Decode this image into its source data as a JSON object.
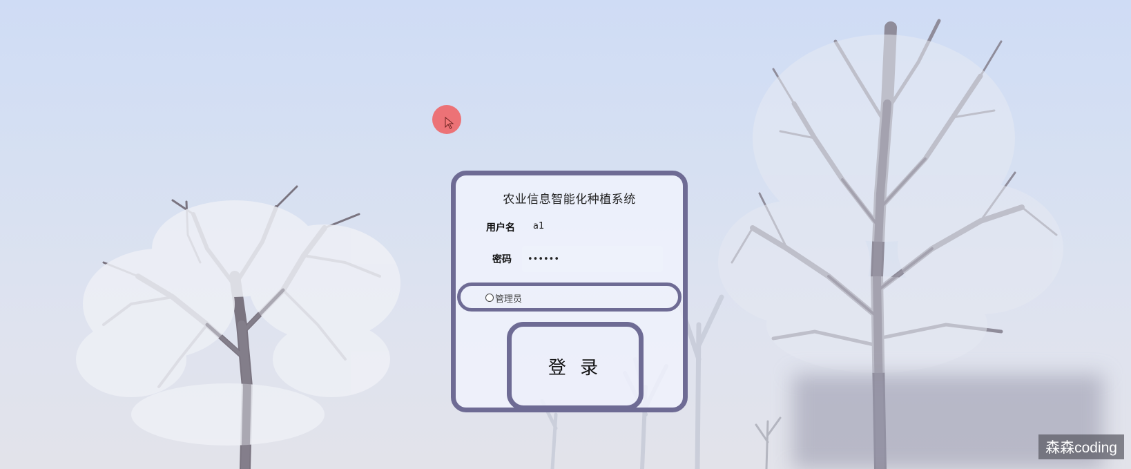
{
  "app": {
    "title": "农业信息智能化种植系统"
  },
  "form": {
    "username_label": "用户名",
    "username_value": "a1",
    "password_label": "密码",
    "password_value": "123456",
    "role_label": "管理员",
    "role_checked": false,
    "login_label": "登 录"
  },
  "overlay": {
    "watermark": "森森coding"
  },
  "colors": {
    "accent": "#6e6b94",
    "sky": "#cfdcf5",
    "cursor": "#f05f5f"
  },
  "icons": {
    "cursor": "mouse-pointer-icon",
    "role": "radio-icon"
  }
}
